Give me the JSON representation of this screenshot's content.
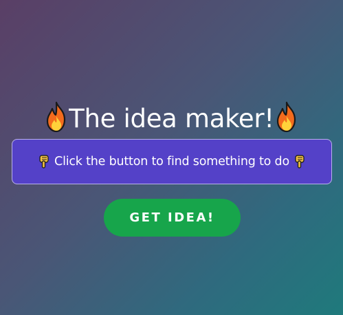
{
  "title": {
    "text": "The idea maker!",
    "left_icon": "fire-icon",
    "right_icon": "fire-icon"
  },
  "message": {
    "text": "Click the button to find something to do",
    "left_icon": "pointing-down-icon",
    "right_icon": "pointing-down-icon"
  },
  "button": {
    "label": "GET IDEA!"
  },
  "colors": {
    "background_start": "#5a3f66",
    "background_end": "#1f7a7c",
    "message_box": "#5441c8",
    "button": "#17a54b",
    "text": "#ffffff"
  }
}
